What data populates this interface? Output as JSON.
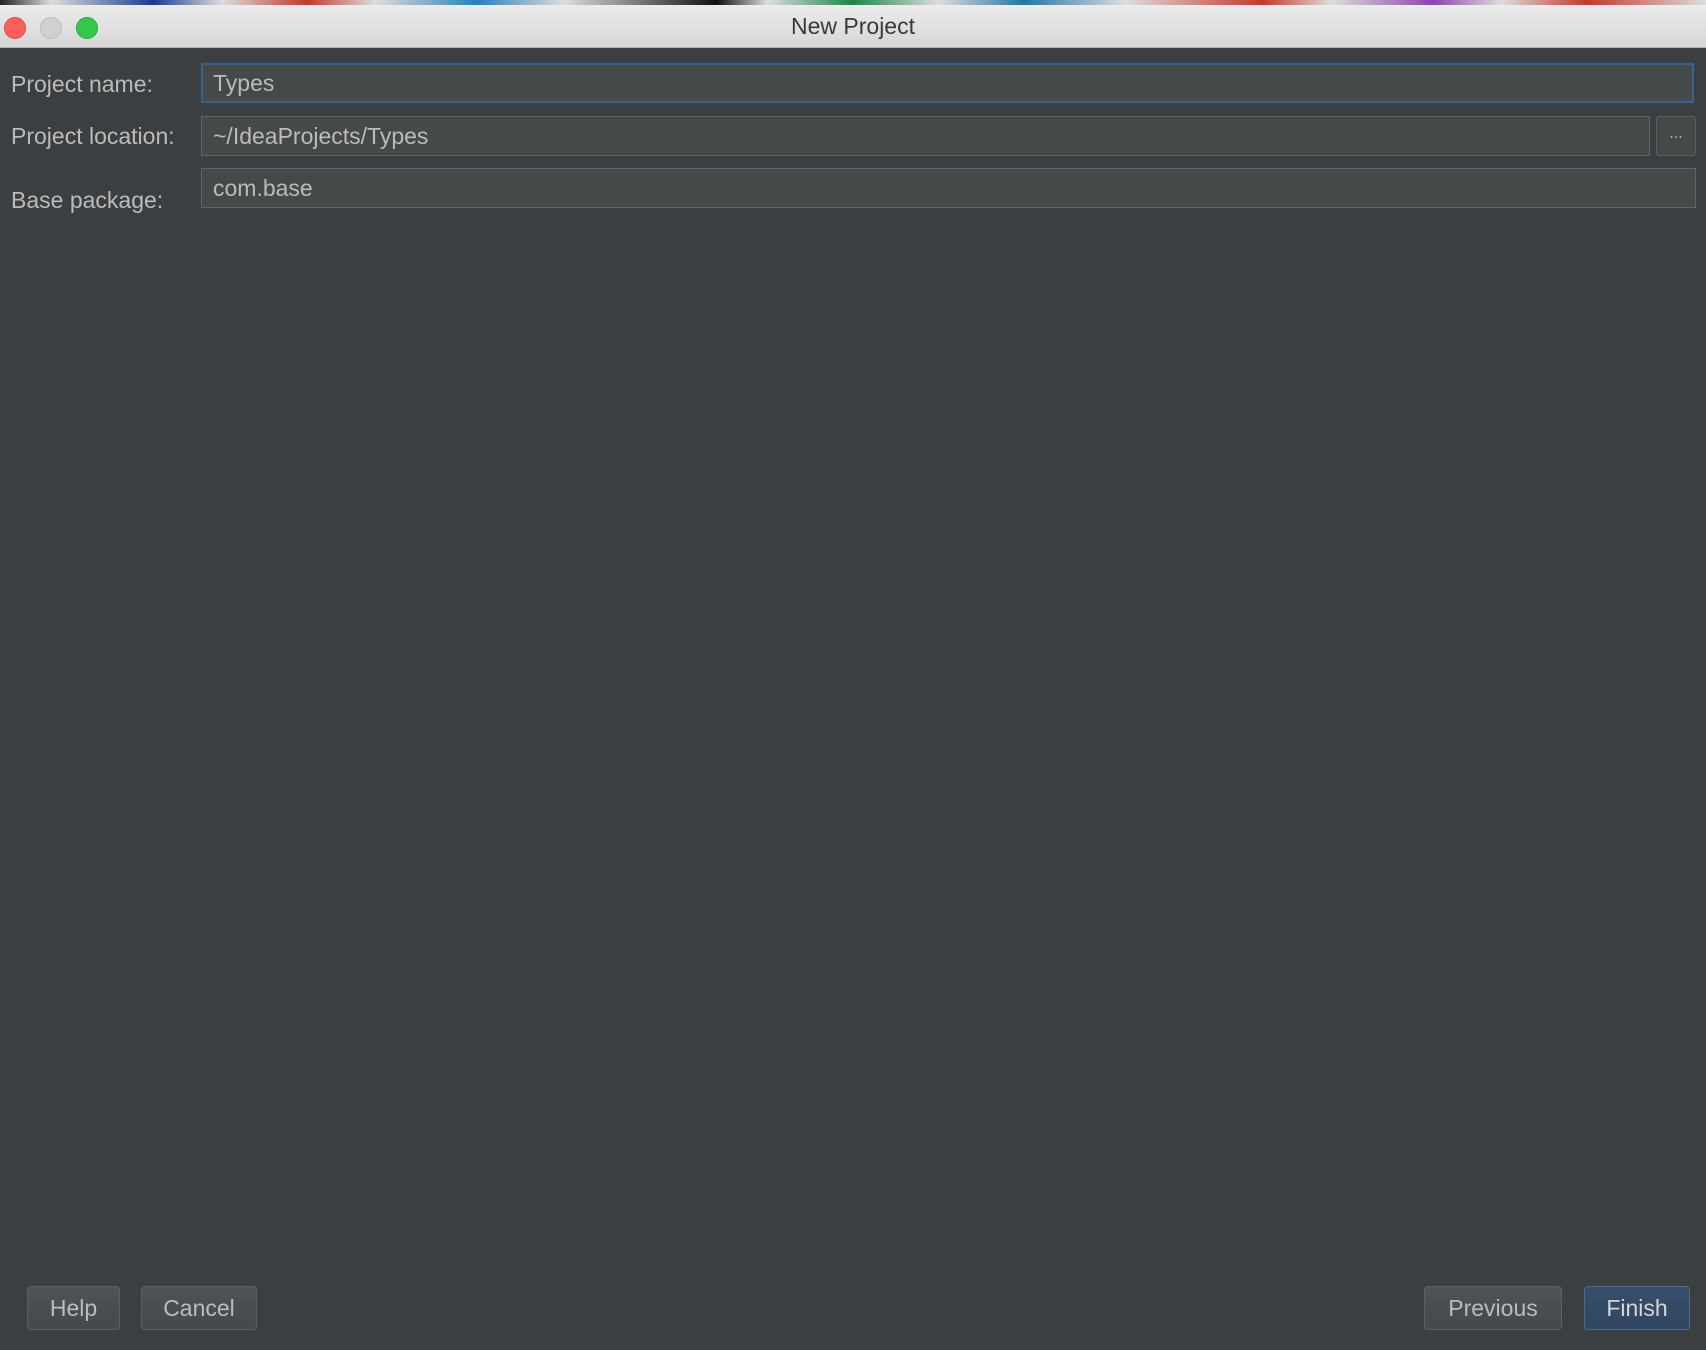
{
  "window": {
    "title": "New Project"
  },
  "form": {
    "project_name_label": "Project name:",
    "project_name_value": "Types",
    "project_location_label": "Project location:",
    "project_location_value": "~/IdeaProjects/Types",
    "browse_label": "...",
    "base_package_label": "Base package:",
    "base_package_value": "com.base"
  },
  "buttons": {
    "help": "Help",
    "cancel": "Cancel",
    "previous": "Previous",
    "finish": "Finish"
  },
  "colors": {
    "background": "#3c3f41",
    "field_bg": "#45494a",
    "focus_border": "#3d6185",
    "text": "#bbbbbb",
    "primary_button": "#2f4560"
  }
}
